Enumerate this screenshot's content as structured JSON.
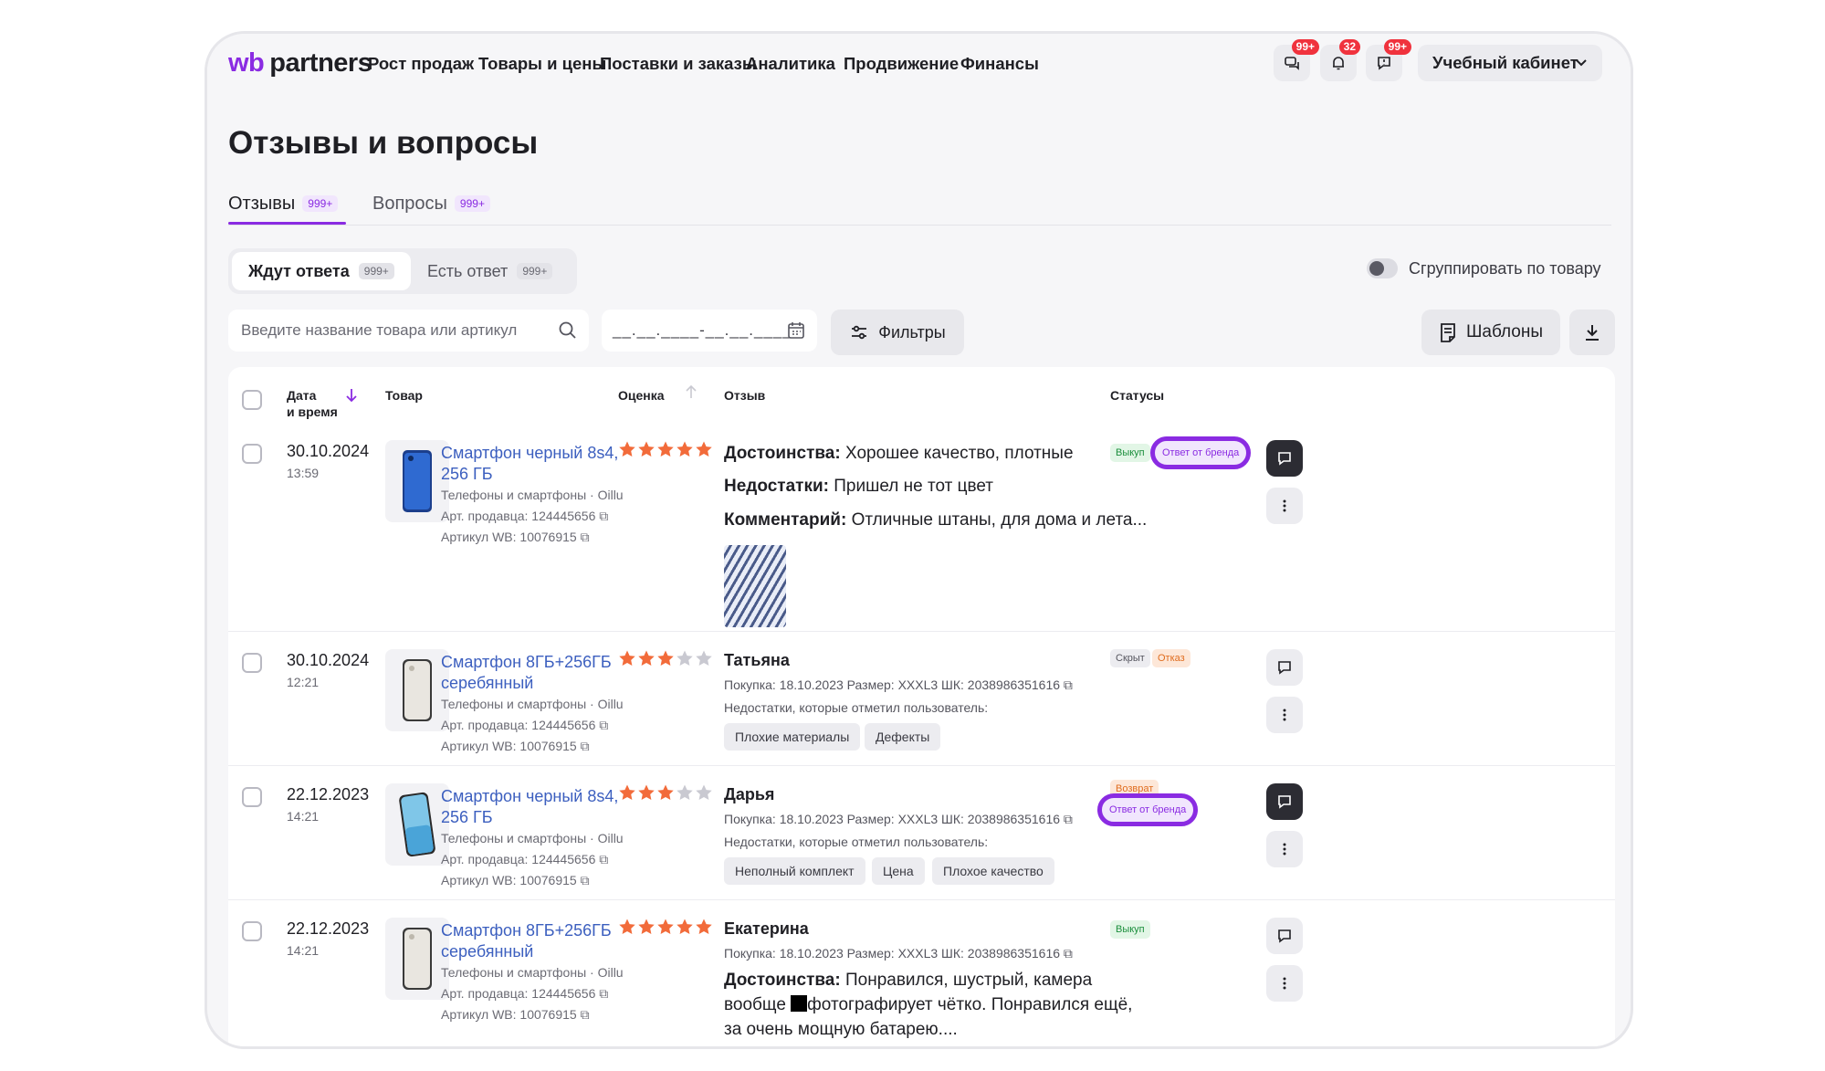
{
  "header": {
    "logo_wb": "wb",
    "logo_partners": "partners",
    "nav": [
      "Рост продаж",
      "Товары и цены",
      "Поставки и заказы",
      "Аналитика",
      "Продвижение",
      "Финансы"
    ],
    "badges": {
      "chat": "99+",
      "notifications": "32",
      "support": "99+"
    },
    "cabinet": "Учебный кабинет"
  },
  "page": {
    "title": "Отзывы и вопросы",
    "tabs": [
      {
        "label": "Отзывы",
        "count": "999+"
      },
      {
        "label": "Вопросы",
        "count": "999+"
      }
    ],
    "segments": [
      {
        "label": "Ждут ответа",
        "count": "999+"
      },
      {
        "label": "Есть ответ",
        "count": "999+"
      }
    ],
    "group_toggle": "Сгруппировать по товару",
    "search_placeholder": "Введите название товара или артикул",
    "date_placeholder": "__.__.____-__.__.____",
    "filters_label": "Фильтры",
    "templates_label": "Шаблоны"
  },
  "table": {
    "columns": {
      "date": "Дата",
      "date2": "и время",
      "product": "Товар",
      "rating": "Оценка",
      "review": "Отзыв",
      "statuses": "Статусы"
    },
    "rows": [
      {
        "date": "30.10.2024",
        "time": "13:59",
        "product": {
          "name": "Смартфон черный 8s4, 256 ГБ",
          "category": "Телефоны и смартфоны · Oillu",
          "seller_sku": "Арт. продавца: 124445656",
          "wb_sku": "Артикул WB: 10076915"
        },
        "rating": 5,
        "review": {
          "pros_label": "Достоинства:",
          "pros": "Хорошее качество, плотные",
          "cons_label": "Недостатки:",
          "cons": "Пришел не тот цвет",
          "comment_label": "Комментарий:",
          "comment": "Отличные штаны, для дома и лета..."
        },
        "tags": [
          "Выкуп",
          "Ответ от бренда"
        ]
      },
      {
        "date": "30.10.2024",
        "time": "12:21",
        "product": {
          "name": "Смартфон 8ГБ+256ГБ серебянный",
          "category": "Телефоны и смартфоны · Oillu",
          "seller_sku": "Арт. продавца: 124445656",
          "wb_sku": "Артикул WB: 10076915"
        },
        "rating": 3,
        "review": {
          "author": "Татьяна",
          "meta": "Покупка: 18.10.2023   Размер: XXXL3   ШК: 2038986351616",
          "flaws_note": "Недостатки, которые отметил пользователь:",
          "chips": [
            "Плохие материалы",
            "Дефекты"
          ]
        },
        "tags": [
          "Скрыт",
          "Отказ"
        ]
      },
      {
        "date": "22.12.2023",
        "time": "14:21",
        "product": {
          "name": "Смартфон черный 8s4, 256 ГБ",
          "category": "Телефоны и смартфоны · Oillu",
          "seller_sku": "Арт. продавца: 124445656",
          "wb_sku": "Артикул WB: 10076915"
        },
        "rating": 3,
        "review": {
          "author": "Дарья",
          "meta": "Покупка: 18.10.2023   Размер: XXXL3   ШК: 2038986351616",
          "flaws_note": "Недостатки, которые отметил пользователь:",
          "chips": [
            "Неполный комплект",
            "Цена",
            "Плохое качество"
          ]
        },
        "tags": [
          "Возврат",
          "Ответ от бренда"
        ]
      },
      {
        "date": "22.12.2023",
        "time": "14:21",
        "product": {
          "name": "Смартфон 8ГБ+256ГБ серебянный",
          "category": "Телефоны и смартфоны · Oillu",
          "seller_sku": "Арт. продавца: 124445656",
          "wb_sku": "Артикул WB: 10076915"
        },
        "rating": 5,
        "review": {
          "author": "Екатерина",
          "meta": "Покупка: 18.10.2023   Размер: XXXL3   ШК: 2038986351616",
          "pros_label": "Достоинства:",
          "pros_line1": "Понравился, шустрый, камера",
          "pros_line2a": "вообще",
          "pros_line2b": "фотографирует чётко. Понравился ещё,",
          "pros_line3": "за очень мощную батарею...."
        },
        "tags": [
          "Выкуп"
        ]
      }
    ]
  },
  "colors": {
    "accent": "#8a2be2",
    "link": "#3c5fbf",
    "star": "#f26b3a",
    "star_empty": "#c9c9d1"
  }
}
